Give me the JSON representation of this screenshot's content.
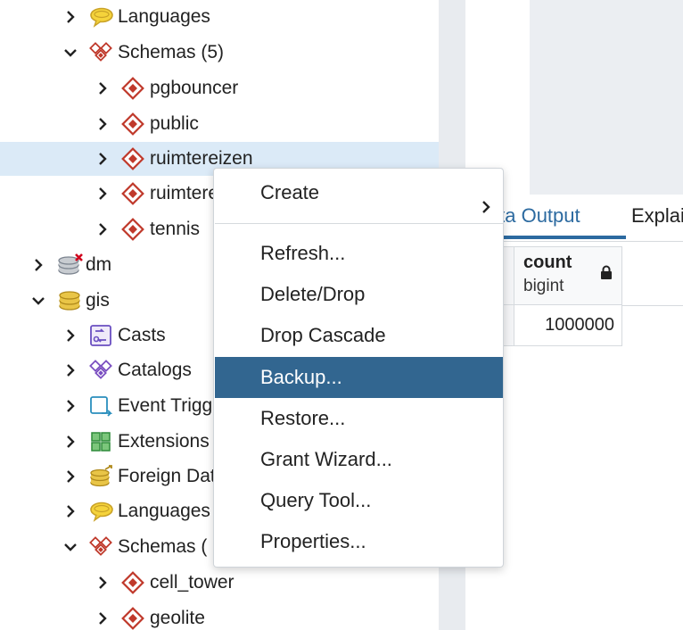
{
  "tree": {
    "rows": [
      {
        "label": "Languages",
        "icon": "languages-icon",
        "chevron": "right"
      },
      {
        "label": "Schemas (5)",
        "icon": "schemas-icon",
        "chevron": "down"
      },
      {
        "label": "pgbouncer",
        "icon": "schema-icon",
        "chevron": "right"
      },
      {
        "label": "public",
        "icon": "schema-icon",
        "chevron": "right"
      },
      {
        "label": "ruimtereizen",
        "icon": "schema-icon",
        "chevron": "right",
        "selected": true
      },
      {
        "label": "ruimtereizen",
        "icon": "schema-icon",
        "chevron": "right"
      },
      {
        "label": "tennis",
        "icon": "schema-icon",
        "chevron": "right"
      },
      {
        "label": "dm",
        "icon": "database-disconnected-icon",
        "chevron": "right"
      },
      {
        "label": "gis",
        "icon": "database-icon",
        "chevron": "down"
      },
      {
        "label": "Casts",
        "icon": "casts-icon",
        "chevron": "right"
      },
      {
        "label": "Catalogs",
        "icon": "catalogs-icon",
        "chevron": "right"
      },
      {
        "label": "Event Triggers",
        "icon": "event-triggers-icon",
        "chevron": "right"
      },
      {
        "label": "Extensions",
        "icon": "extensions-icon",
        "chevron": "right"
      },
      {
        "label": "Foreign Data Wrappers",
        "icon": "foreign-data-wrappers-icon",
        "chevron": "right"
      },
      {
        "label": "Languages",
        "icon": "languages-icon",
        "chevron": "right"
      },
      {
        "label": "Schemas (",
        "icon": "schemas-icon",
        "chevron": "down"
      },
      {
        "label": "cell_tower",
        "icon": "schema-icon",
        "chevron": "right"
      },
      {
        "label": "geolite",
        "icon": "schema-icon",
        "chevron": "right"
      }
    ]
  },
  "context_menu": {
    "create": "Create",
    "refresh": "Refresh...",
    "delete_drop": "Delete/Drop",
    "drop_cascade": "Drop Cascade",
    "backup": "Backup...",
    "restore": "Restore...",
    "grant_wizard": "Grant Wizard...",
    "query_tool": "Query Tool...",
    "properties": "Properties..."
  },
  "results": {
    "tab_data_output": "Data Output",
    "tab_explain": "Explain",
    "column_name": "count",
    "column_type": "bigint",
    "cell_value": "1000000"
  },
  "colors": {
    "accent": "#326690",
    "selection": "#dbeaf7",
    "schema_red": "#c0392b",
    "db_gold": "#c9a227"
  }
}
